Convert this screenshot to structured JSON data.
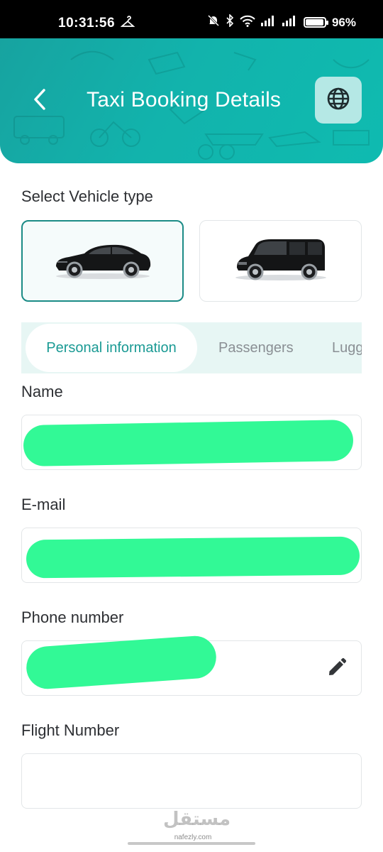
{
  "status_bar": {
    "time": "10:31:56",
    "battery_percent": "96%",
    "battery_level": 0.96
  },
  "header": {
    "title": "Taxi Booking Details",
    "back_icon": "chevron-left-icon",
    "language_icon": "globe-icon",
    "gradient_colors": [
      "#17a3a0",
      "#0fbbb0"
    ]
  },
  "vehicle_section": {
    "label": "Select Vehicle type",
    "options": [
      {
        "type": "sedan",
        "selected": true,
        "icon": "sedan-car-image"
      },
      {
        "type": "van",
        "selected": false,
        "icon": "van-image"
      }
    ]
  },
  "tabs": [
    {
      "label": "Personal information",
      "active": true
    },
    {
      "label": "Passengers",
      "active": false
    },
    {
      "label": "Lugg",
      "active": false
    }
  ],
  "form": {
    "name_label": "Name",
    "name_value": "",
    "email_label": "E-mail",
    "email_value": "",
    "phone_label": "Phone number",
    "phone_value": "",
    "flight_label": "Flight Number",
    "flight_value": ""
  },
  "colors": {
    "accent": "#1a9a94",
    "selected_border": "#1b8b86",
    "tab_bar_bg": "#e7f6f4",
    "redaction": "#32f996"
  },
  "watermark": {
    "logo_text": "مستقل",
    "site": "nafezly.com"
  }
}
